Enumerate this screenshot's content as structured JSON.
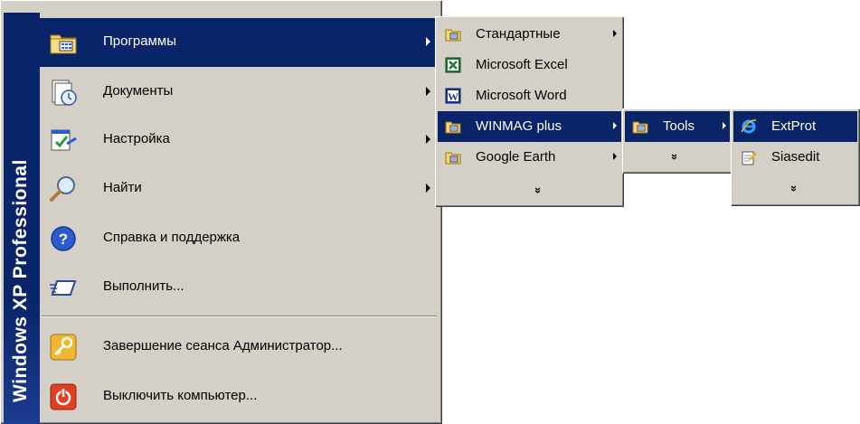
{
  "banner": {
    "part1": "Windows XP",
    "part2": "Professional"
  },
  "start_menu": {
    "items": [
      {
        "label": "Программы"
      },
      {
        "label": "Документы"
      },
      {
        "label": "Настройка"
      },
      {
        "label": "Найти"
      },
      {
        "label": "Справка и поддержка"
      },
      {
        "label": "Выполнить..."
      },
      {
        "label": "Завершение сеанса Администратор..."
      },
      {
        "label": "Выключить компьютер..."
      }
    ]
  },
  "programs_menu": {
    "items": [
      {
        "label": "Стандартные"
      },
      {
        "label": "Microsoft Excel"
      },
      {
        "label": "Microsoft Word"
      },
      {
        "label": "WINMAG plus"
      },
      {
        "label": "Google Earth"
      }
    ],
    "more": "»"
  },
  "winmag_menu": {
    "items": [
      {
        "label": "Tools"
      }
    ],
    "more": "»"
  },
  "tools_menu": {
    "items": [
      {
        "label": "ExtProt"
      },
      {
        "label": "Siasedit"
      }
    ],
    "more": "»"
  },
  "colors": {
    "menu_face": "#d4d0c8",
    "highlight": "#0a246a",
    "banner": "#0a246a"
  }
}
